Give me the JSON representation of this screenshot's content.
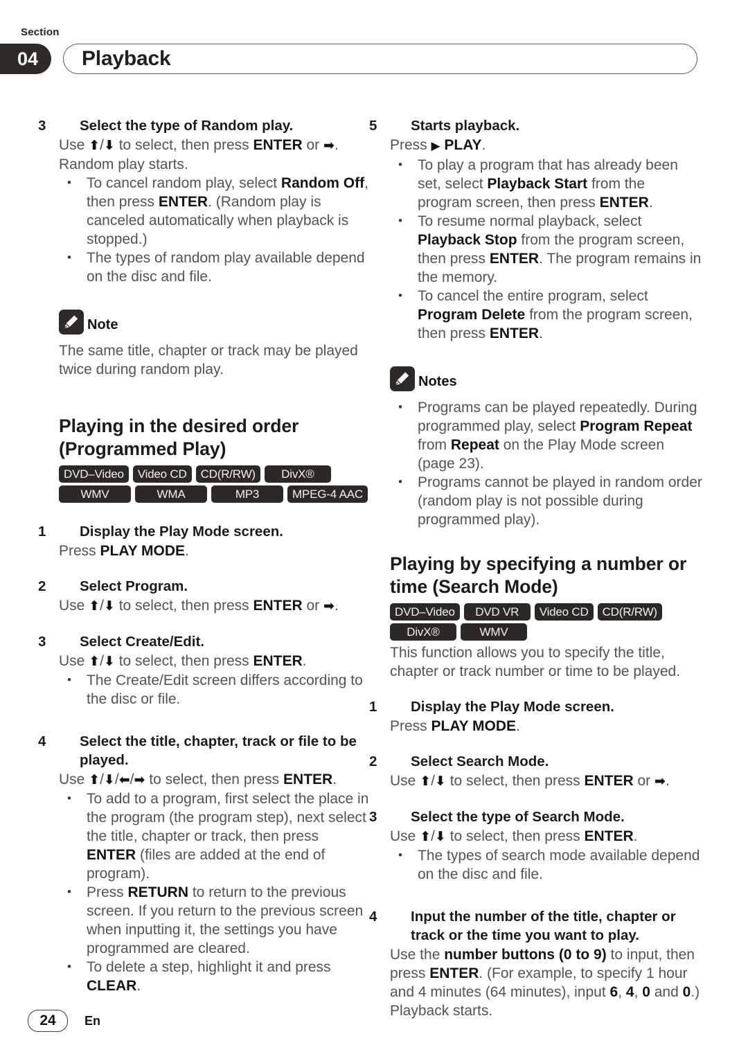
{
  "header": {
    "section_label": "Section",
    "section_number": "04",
    "title": "Playback"
  },
  "left_column": {
    "step3": {
      "num": "3",
      "title": "Select the type of Random play.",
      "line1_a": "Use ",
      "line1_up": "⬆",
      "line1_slash": "/",
      "line1_down": "⬇",
      "line1_b": " to select, then press ",
      "line1_enter": "ENTER",
      "line1_c": " or ",
      "line1_right": "➡",
      "line1_d": ".",
      "line2": "Random play starts.",
      "bullets": [
        {
          "a": "To cancel random play, select ",
          "b1": "Random Off",
          "c": ", then press ",
          "b2": "ENTER",
          "d": ". (Random play is canceled automatically when playback is stopped.)"
        },
        {
          "a": "The types of random play available depend on the disc and file."
        }
      ]
    },
    "note": {
      "label": "Note",
      "body": "The same title, chapter or track may be played twice during random play."
    },
    "section_heading": "Playing in the desired order (Programmed Play)",
    "badges": [
      [
        "DVD–Video",
        "Video CD",
        "CD(R/RW)",
        "DivX®"
      ],
      [
        "WMV",
        "WMA",
        "MP3",
        "MPEG-4 AAC"
      ]
    ],
    "step1": {
      "num": "1",
      "title": "Display the Play Mode screen.",
      "line_a": "Press ",
      "line_b": "PLAY MODE",
      "line_c": "."
    },
    "step2": {
      "num": "2",
      "title": "Select Program.",
      "line_a": "Use ",
      "up": "⬆",
      "slash": "/",
      "down": "⬇",
      "line_b": " to select, then press ",
      "enter": "ENTER",
      "line_c": " or ",
      "right": "➡",
      "line_d": "."
    },
    "step3b": {
      "num": "3",
      "title": "Select Create/Edit.",
      "line_a": "Use ",
      "up": "⬆",
      "slash": "/",
      "down": "⬇",
      "line_b": " to select, then press ",
      "enter": "ENTER",
      "line_c": ".",
      "bullet": "The Create/Edit screen differs according to the disc or file."
    },
    "step4": {
      "num": "4",
      "title": "Select the title, chapter, track or file to be played.",
      "line_a": "Use ",
      "up": "⬆",
      "s1": "/",
      "down": "⬇",
      "s2": "/",
      "left": "⬅",
      "s3": "/",
      "right": "➡",
      "line_b": " to select, then press ",
      "enter": "ENTER",
      "line_c": ".",
      "bullets": [
        {
          "a": "To add to a program, first select the place in the program (the program step), next select the title, chapter or track, then press ",
          "b1": "ENTER",
          "c": " (files are added at the end of program)."
        },
        {
          "a": "Press ",
          "b1": "RETURN",
          "c": " to return to the previous screen. If you return to the previous screen when inputting it, the settings you have programmed are cleared."
        },
        {
          "a": "To delete a step, highlight it and press ",
          "b1": "CLEAR",
          "c": "."
        }
      ]
    }
  },
  "right_column": {
    "step5": {
      "num": "5",
      "title": "Starts playback.",
      "line_a": "Press ",
      "tri": "▶",
      "line_b": " PLAY",
      "line_c": ".",
      "bullets": [
        {
          "a": "To play a program that has already been set, select ",
          "b1": "Playback Start",
          "c": " from the program screen, then press ",
          "b2": "ENTER",
          "d": "."
        },
        {
          "a": "To resume normal playback, select ",
          "b1": "Playback Stop",
          "c": " from the program screen, then press ",
          "b2": "ENTER",
          "d": ". The program remains in the memory."
        },
        {
          "a": "To cancel the entire program, select ",
          "b1": "Program Delete",
          "c": " from the program screen, then press ",
          "b2": "ENTER",
          "d": "."
        }
      ]
    },
    "notes": {
      "label": "Notes",
      "bullets": [
        {
          "a": "Programs can be played repeatedly. During programmed play, select ",
          "b1": "Program Repeat",
          "c": " from ",
          "b2": "Repeat",
          "d": " on the Play Mode screen (page 23)."
        },
        {
          "a": "Programs cannot be played in random order (random play is not possible during programmed play)."
        }
      ]
    },
    "section_heading": "Playing by specifying a number or time (Search Mode)",
    "badges": [
      [
        "DVD–Video",
        "DVD VR",
        "Video CD",
        "CD(R/RW)"
      ],
      [
        "DivX®",
        "WMV"
      ]
    ],
    "intro": "This function allows you to specify the title, chapter or track number or time to be played.",
    "step1": {
      "num": "1",
      "title": "Display the Play Mode screen.",
      "line_a": "Press ",
      "line_b": "PLAY MODE",
      "line_c": "."
    },
    "step2": {
      "num": "2",
      "title": "Select Search Mode.",
      "line_a": "Use ",
      "up": "⬆",
      "slash": "/",
      "down": "⬇",
      "line_b": " to select, then press ",
      "enter": "ENTER",
      "line_c": " or ",
      "right": "➡",
      "line_d": "."
    },
    "step3": {
      "num": "3",
      "title": "Select the type of Search Mode.",
      "line_a": "Use ",
      "up": "⬆",
      "slash": "/",
      "down": "⬇",
      "line_b": " to select, then press ",
      "enter": "ENTER",
      "line_c": ".",
      "bullet": "The types of search mode available depend on the disc and file."
    },
    "step4": {
      "num": "4",
      "title": "Input the number of the title, chapter or track or the time you want to play.",
      "a": "Use the ",
      "b1": "number buttons (0 to 9)",
      "c": " to input, then press ",
      "b2": "ENTER",
      "d": ". (For example, to specify 1 hour and 4 minutes (64 minutes), input ",
      "b3": "6",
      "e": ", ",
      "b4": "4",
      "f": ", ",
      "b5": "0",
      "g": " and ",
      "b6": "0",
      "h": ".)",
      "last": "Playback starts."
    }
  },
  "footer": {
    "page_number": "24",
    "language": "En"
  }
}
